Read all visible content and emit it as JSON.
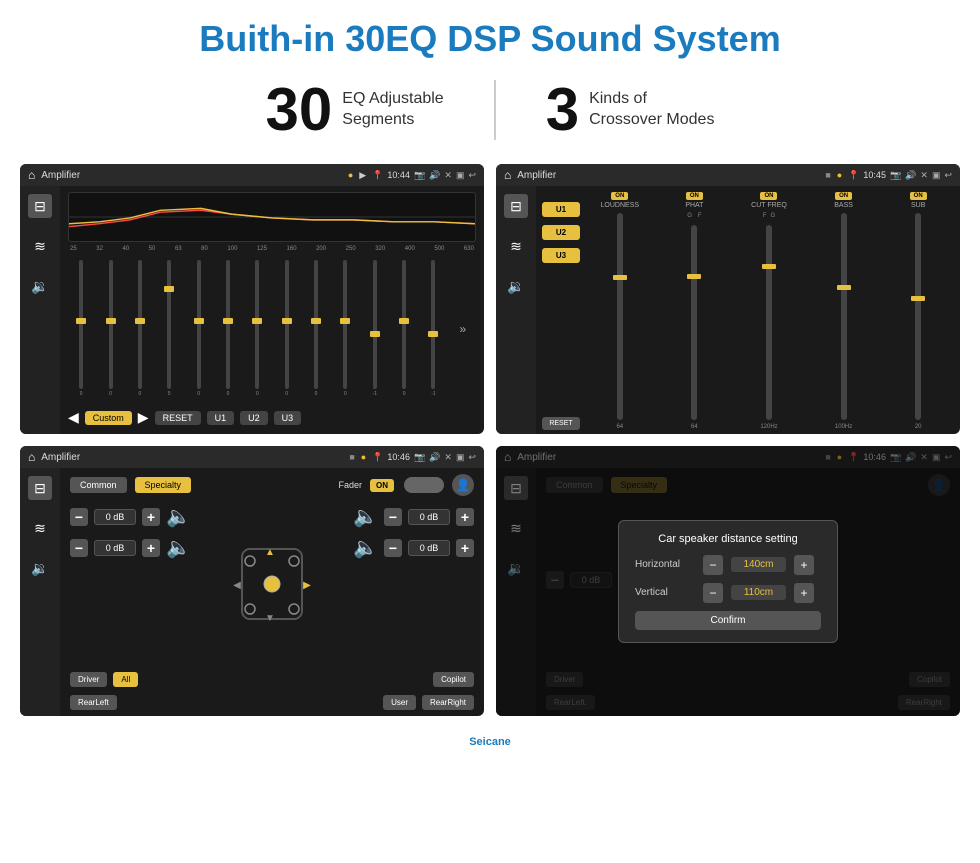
{
  "page": {
    "title": "Buith-in 30EQ DSP Sound System",
    "stat1_number": "30",
    "stat1_label_line1": "EQ Adjustable",
    "stat1_label_line2": "Segments",
    "stat2_number": "3",
    "stat2_label_line1": "Kinds of",
    "stat2_label_line2": "Crossover Modes",
    "watermark": "Seicane"
  },
  "screen1": {
    "topbar_title": "Amplifier",
    "topbar_time": "10:44",
    "freq_labels": [
      "25",
      "32",
      "40",
      "50",
      "63",
      "80",
      "100",
      "125",
      "160",
      "200",
      "250",
      "320",
      "400",
      "500",
      "630"
    ],
    "eq_values": [
      "0",
      "0",
      "0",
      "5",
      "0",
      "0",
      "0",
      "0",
      "0",
      "0",
      "-1",
      "0",
      "-1"
    ],
    "custom_label": "Custom",
    "reset_label": "RESET",
    "u1_label": "U1",
    "u2_label": "U2",
    "u3_label": "U3"
  },
  "screen2": {
    "topbar_title": "Amplifier",
    "topbar_time": "10:45",
    "u1": "U1",
    "u2": "U2",
    "u3": "U3",
    "loudness_on": "ON",
    "loudness_label": "LOUDNESS",
    "phat_on": "ON",
    "phat_label": "PHAT",
    "cutfreq_on": "ON",
    "cutfreq_label": "CUT FREQ",
    "bass_on": "ON",
    "bass_label": "BASS",
    "sub_on": "ON",
    "sub_label": "SUB",
    "reset_label": "RESET"
  },
  "screen3": {
    "topbar_title": "Amplifier",
    "topbar_time": "10:46",
    "common_label": "Common",
    "specialty_label": "Specialty",
    "fader_label": "Fader",
    "fader_on": "ON",
    "db_values": [
      "0 dB",
      "0 dB",
      "0 dB",
      "0 dB"
    ],
    "driver_label": "Driver",
    "all_label": "All",
    "copilot_label": "Copilot",
    "user_label": "User",
    "rearleft_label": "RearLeft",
    "rearright_label": "RearRight"
  },
  "screen4": {
    "topbar_title": "Amplifier",
    "topbar_time": "10:46",
    "common_label": "Common",
    "specialty_label": "Specialty",
    "dialog_title": "Car speaker distance setting",
    "horizontal_label": "Horizontal",
    "horizontal_value": "140cm",
    "vertical_label": "Vertical",
    "vertical_value": "110cm",
    "confirm_label": "Confirm",
    "db_values": [
      "0 dB",
      "0 dB"
    ],
    "driver_label": "Driver",
    "copilot_label": "Copilot",
    "rearleft_label": "RearLeft.",
    "rearright_label": "RearRight"
  }
}
